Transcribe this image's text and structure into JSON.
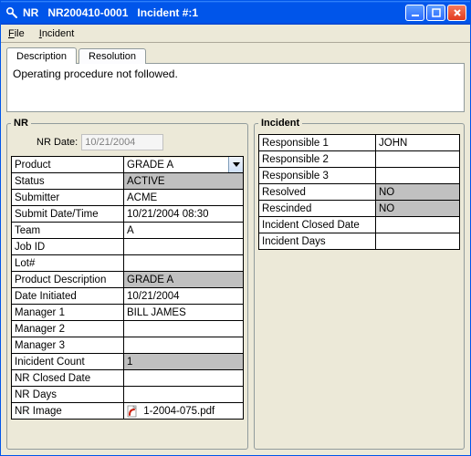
{
  "window": {
    "title": "NR   NR200410-0001   Incident #:1"
  },
  "menu": {
    "file": "File",
    "incident": "Incident"
  },
  "tabs": {
    "description": "Description",
    "resolution": "Resolution"
  },
  "description_text": "Operating procedure not followed.",
  "nr": {
    "legend": "NR",
    "date_label": "NR Date:",
    "date_value": "10/21/2004",
    "rows": [
      {
        "label": "Product",
        "value": "GRADE A",
        "type": "combo",
        "shade": false
      },
      {
        "label": "Status",
        "value": "ACTIVE",
        "shade": true
      },
      {
        "label": "Submitter",
        "value": "ACME",
        "shade": false
      },
      {
        "label": "Submit Date/Time",
        "value": "10/21/2004 08:30",
        "shade": false
      },
      {
        "label": "Team",
        "value": "A",
        "shade": false
      },
      {
        "label": "Job ID",
        "value": "",
        "shade": false
      },
      {
        "label": "Lot#",
        "value": "",
        "shade": false
      },
      {
        "label": "Product Description",
        "value": "GRADE A",
        "shade": true
      },
      {
        "label": "Date Initiated",
        "value": "10/21/2004",
        "shade": false
      },
      {
        "label": "Manager 1",
        "value": "BILL JAMES",
        "shade": false
      },
      {
        "label": "Manager 2",
        "value": "",
        "shade": false
      },
      {
        "label": "Manager 3",
        "value": "",
        "shade": false
      },
      {
        "label": "Inicident Count",
        "value": "1",
        "shade": true
      },
      {
        "label": "NR Closed Date",
        "value": "",
        "shade": false
      },
      {
        "label": "NR Days",
        "value": "",
        "shade": false
      },
      {
        "label": "NR Image",
        "value": "1-2004-075.pdf",
        "type": "file",
        "shade": false
      }
    ]
  },
  "incident": {
    "legend": "Incident",
    "rows": [
      {
        "label": "Responsible 1",
        "value": "JOHN",
        "shade": false
      },
      {
        "label": "Responsible 2",
        "value": "",
        "shade": false
      },
      {
        "label": "Responsible 3",
        "value": "",
        "shade": false
      },
      {
        "label": "Resolved",
        "value": "NO",
        "shade": true
      },
      {
        "label": "Rescinded",
        "value": "NO",
        "shade": true
      },
      {
        "label": "Incident Closed Date",
        "value": "",
        "shade": false
      },
      {
        "label": "Incident Days",
        "value": "",
        "shade": false
      }
    ]
  }
}
